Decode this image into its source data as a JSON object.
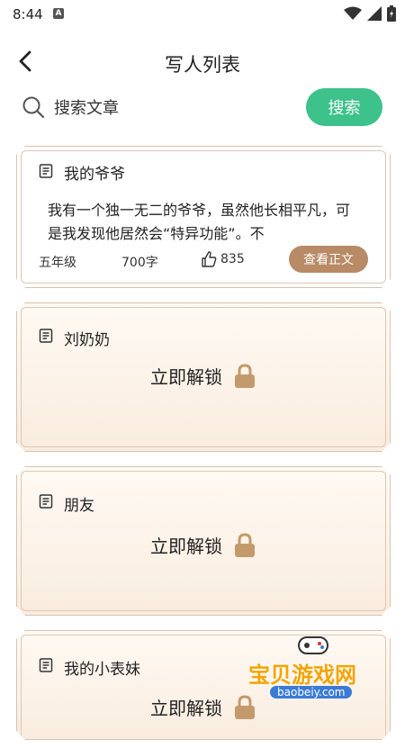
{
  "status_bar": {
    "time": "8:44",
    "notification_letter": "A"
  },
  "header": {
    "title": "写人列表"
  },
  "search": {
    "placeholder": "搜索文章",
    "button_label": "搜索"
  },
  "colors": {
    "accent_green": "#3cc28a",
    "brown_button": "#b88a66",
    "lock_color": "#c49a6c"
  },
  "articles": [
    {
      "title": "我的爷爷",
      "excerpt": "我有一个独一无二的爷爷，虽然他长相平凡，可是我发现他居然会“特异功能”。不",
      "grade": "五年级",
      "words": "700字",
      "likes": "835",
      "read_label": "查看正文"
    },
    {
      "title": "刘奶奶",
      "unlock_label": "立即解锁"
    },
    {
      "title": "朋友",
      "unlock_label": "立即解锁"
    },
    {
      "title": "我的小表妹",
      "unlock_label": "立即解锁"
    }
  ],
  "watermark": {
    "text": "宝贝游戏网",
    "url": "baobeiy.com"
  }
}
